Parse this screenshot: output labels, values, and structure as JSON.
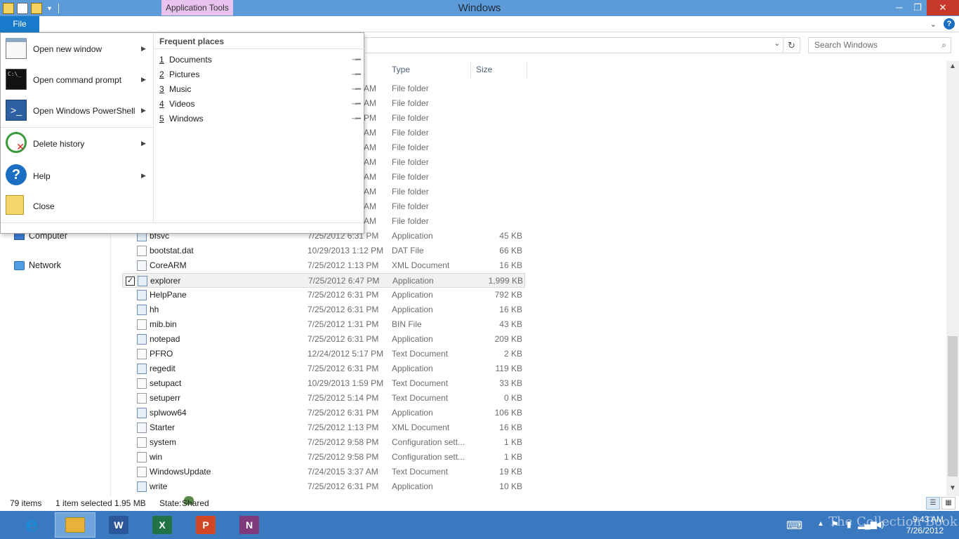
{
  "titlebar": {
    "context_tab": "Application Tools",
    "title": "Windows",
    "buttons": [
      "minimize",
      "restore",
      "close"
    ]
  },
  "ribbon": {
    "file_tab": "File"
  },
  "search": {
    "placeholder": "Search Windows"
  },
  "file_menu": {
    "items": [
      {
        "label": "Open new window",
        "icon": "new-window-icon",
        "has_submenu": true
      },
      {
        "label": "Open command prompt",
        "icon": "command-prompt-icon",
        "has_submenu": true
      },
      {
        "label": "Open Windows PowerShell",
        "icon": "powershell-icon",
        "has_submenu": true
      },
      {
        "label": "Delete history",
        "icon": "delete-history-icon",
        "has_submenu": true
      },
      {
        "label": "Help",
        "icon": "help-icon",
        "has_submenu": true
      },
      {
        "label": "Close",
        "icon": "close-folder-icon",
        "has_submenu": false
      }
    ],
    "frequent_title": "Frequent places",
    "frequent_places": [
      {
        "num": "1",
        "label": "Documents"
      },
      {
        "num": "2",
        "label": "Pictures"
      },
      {
        "num": "3",
        "label": "Music"
      },
      {
        "num": "4",
        "label": "Videos"
      },
      {
        "num": "5",
        "label": "Windows"
      }
    ]
  },
  "nav": {
    "computer": "Computer",
    "network": "Network"
  },
  "columns": {
    "type": "Type",
    "size": "Size"
  },
  "hidden_rows": [
    {
      "time": "AM",
      "type": "File folder"
    },
    {
      "time": "AM",
      "type": "File folder"
    },
    {
      "time": "PM",
      "type": "File folder"
    },
    {
      "time": "AM",
      "type": "File folder"
    },
    {
      "time": "AM",
      "type": "File folder"
    },
    {
      "time": "AM",
      "type": "File folder"
    },
    {
      "time": "AM",
      "type": "File folder"
    },
    {
      "time": "AM",
      "type": "File folder"
    },
    {
      "time": "AM",
      "type": "File folder"
    },
    {
      "time": "AM",
      "type": "File folder"
    }
  ],
  "files": [
    {
      "name": "bfsvc",
      "date": "7/25/2012 6:31 PM",
      "type": "Application",
      "size": "45 KB",
      "icon": "app"
    },
    {
      "name": "bootstat.dat",
      "date": "10/29/2013 1:12 PM",
      "type": "DAT File",
      "size": "66 KB",
      "icon": "file"
    },
    {
      "name": "CoreARM",
      "date": "7/25/2012 1:13 PM",
      "type": "XML Document",
      "size": "16 KB",
      "icon": "xml"
    },
    {
      "name": "explorer",
      "date": "7/25/2012 6:47 PM",
      "type": "Application",
      "size": "1,999 KB",
      "icon": "app",
      "selected": true
    },
    {
      "name": "HelpPane",
      "date": "7/25/2012 6:31 PM",
      "type": "Application",
      "size": "792 KB",
      "icon": "app"
    },
    {
      "name": "hh",
      "date": "7/25/2012 6:31 PM",
      "type": "Application",
      "size": "16 KB",
      "icon": "app"
    },
    {
      "name": "mib.bin",
      "date": "7/25/2012 1:31 PM",
      "type": "BIN File",
      "size": "43 KB",
      "icon": "file"
    },
    {
      "name": "notepad",
      "date": "7/25/2012 6:31 PM",
      "type": "Application",
      "size": "209 KB",
      "icon": "app"
    },
    {
      "name": "PFRO",
      "date": "12/24/2012 5:17 PM",
      "type": "Text Document",
      "size": "2 KB",
      "icon": "file"
    },
    {
      "name": "regedit",
      "date": "7/25/2012 6:31 PM",
      "type": "Application",
      "size": "119 KB",
      "icon": "app"
    },
    {
      "name": "setupact",
      "date": "10/29/2013 1:59 PM",
      "type": "Text Document",
      "size": "33 KB",
      "icon": "file"
    },
    {
      "name": "setuperr",
      "date": "7/25/2012 5:14 PM",
      "type": "Text Document",
      "size": "0 KB",
      "icon": "file"
    },
    {
      "name": "splwow64",
      "date": "7/25/2012 6:31 PM",
      "type": "Application",
      "size": "106 KB",
      "icon": "app"
    },
    {
      "name": "Starter",
      "date": "7/25/2012 1:13 PM",
      "type": "XML Document",
      "size": "16 KB",
      "icon": "xml"
    },
    {
      "name": "system",
      "date": "7/25/2012 9:58 PM",
      "type": "Configuration sett...",
      "size": "1 KB",
      "icon": "file"
    },
    {
      "name": "win",
      "date": "7/25/2012 9:58 PM",
      "type": "Configuration sett...",
      "size": "1 KB",
      "icon": "file"
    },
    {
      "name": "WindowsUpdate",
      "date": "7/24/2015 3:37 AM",
      "type": "Text Document",
      "size": "19 KB",
      "icon": "file"
    },
    {
      "name": "write",
      "date": "7/25/2012 6:31 PM",
      "type": "Application",
      "size": "10 KB",
      "icon": "app"
    }
  ],
  "status": {
    "items_count": "79 items",
    "selected": "1 item selected",
    "size": "1.95 MB",
    "state_label": "State:",
    "state_value": "Shared"
  },
  "taskbar": {
    "apps": [
      {
        "name": "internet-explorer",
        "glyph": "e",
        "color": "#1e8ad6"
      },
      {
        "name": "file-explorer",
        "glyph": "",
        "color": "#e8b23a",
        "active": true
      },
      {
        "name": "word",
        "glyph": "W",
        "color": "#2b579a"
      },
      {
        "name": "excel",
        "glyph": "X",
        "color": "#217346"
      },
      {
        "name": "powerpoint",
        "glyph": "P",
        "color": "#d24726"
      },
      {
        "name": "onenote",
        "glyph": "N",
        "color": "#80397b"
      }
    ],
    "time": "9:43 AM",
    "date": "7/26/2012",
    "watermark": "The Collection Book"
  }
}
